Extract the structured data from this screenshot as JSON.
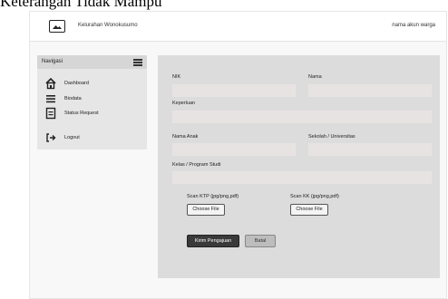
{
  "caption": "Keterangan Tidak Mampu",
  "header": {
    "brand": "Kelurahan Wonokusumo",
    "account": "nama akun warga",
    "logo_icon": "image-icon"
  },
  "sidebar": {
    "title": "Navigasi",
    "menu_icon": "hamburger-icon",
    "items": [
      {
        "label": "Dashboard",
        "icon": "home-icon"
      },
      {
        "label": "Biodata",
        "icon": "list-icon"
      },
      {
        "label": "Status Request",
        "icon": "document-icon"
      },
      {
        "label": "Logout",
        "icon": "logout-icon"
      }
    ]
  },
  "form": {
    "nik_label": "NIK",
    "nama_label": "Nama",
    "keperluan_label": "Keperluan",
    "nama_anak_label": "Nama Anak",
    "sekolah_label": "Sekolah / Universitas",
    "kelas_label": "Kelas / Program Studi",
    "nik_value": "",
    "nama_value": "",
    "keperluan_value": "",
    "nama_anak_value": "",
    "sekolah_value": "",
    "kelas_value": "",
    "scan_ktp_label": "Scan KTP (jpg/png,pdf)",
    "scan_kk_label": "Scan KK (jpg/png,pdf)",
    "choose_file_label": "Choose File",
    "submit_label": "Kirim Pengajuan",
    "cancel_label": "Batal"
  }
}
